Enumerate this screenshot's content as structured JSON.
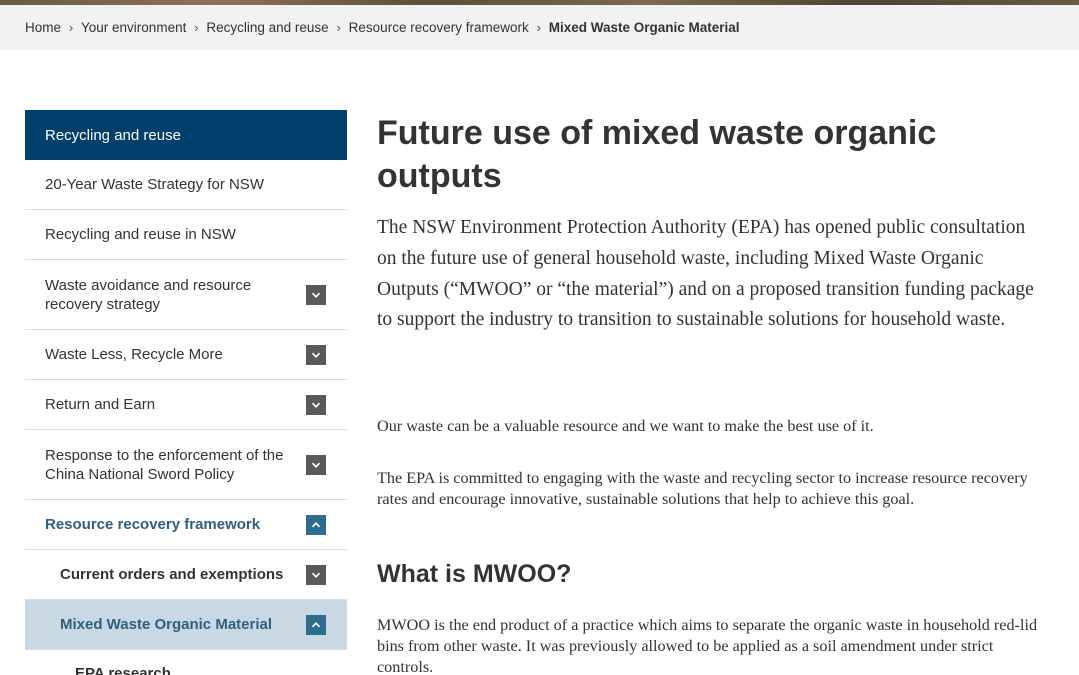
{
  "breadcrumb": {
    "items": [
      "Home",
      "Your environment",
      "Recycling and reuse",
      "Resource recovery framework"
    ],
    "current": "Mixed Waste Organic Material"
  },
  "sidebar": {
    "heading": "Recycling and reuse",
    "items": [
      {
        "label": "20-Year Waste Strategy for NSW",
        "toggle": null
      },
      {
        "label": "Recycling and reuse in NSW",
        "toggle": null
      },
      {
        "label": "Waste avoidance and resource recovery strategy",
        "toggle": "expand"
      },
      {
        "label": "Waste Less, Recycle More",
        "toggle": "expand"
      },
      {
        "label": "Return and Earn",
        "toggle": "expand"
      },
      {
        "label": "Response to the enforcement of the China National Sword Policy",
        "toggle": "expand"
      },
      {
        "label": "Resource recovery framework",
        "toggle": "collapse"
      },
      {
        "label": "Current orders and exemptions",
        "toggle": "expand"
      },
      {
        "label": "Mixed Waste Organic Material",
        "toggle": "collapse"
      },
      {
        "label": "EPA research",
        "toggle": null
      }
    ]
  },
  "main": {
    "title": "Future use of mixed waste organic outputs",
    "intro": "The NSW Environment Protection Authority (EPA) has opened public consultation on the future use of general household waste, including Mixed Waste Organic Outputs (“MWOO” or “the material”) and on a proposed transition funding package to support the industry to transition to sustainable solutions for household waste.",
    "paragraph_1": "Our waste can be a valuable resource and we want to make the best use of it.",
    "paragraph_2": "The EPA is committed to engaging with the waste and recycling sector to increase resource recovery rates and encourage innovative, sustainable solutions that help to achieve this goal.",
    "section_heading": "What is MWOO?",
    "paragraph_3": "MWOO is the end product of a practice which aims to separate the organic waste in household red-lid bins from other waste. It was previously allowed to be applied as a soil amendment under strict controls."
  },
  "colors": {
    "nav_heading_bg": "#003e6b",
    "active_link": "#2e5f7f",
    "current_item_bg": "#c9d9e3",
    "toggle_bg": "#5a5a5a",
    "toggle_active_bg": "#2e6c8e",
    "breadcrumb_bg": "#f2f2f2"
  },
  "icons": {
    "breadcrumb_separator": "chevron-right-icon",
    "expand": "chevron-down-icon",
    "collapse": "chevron-up-icon"
  }
}
